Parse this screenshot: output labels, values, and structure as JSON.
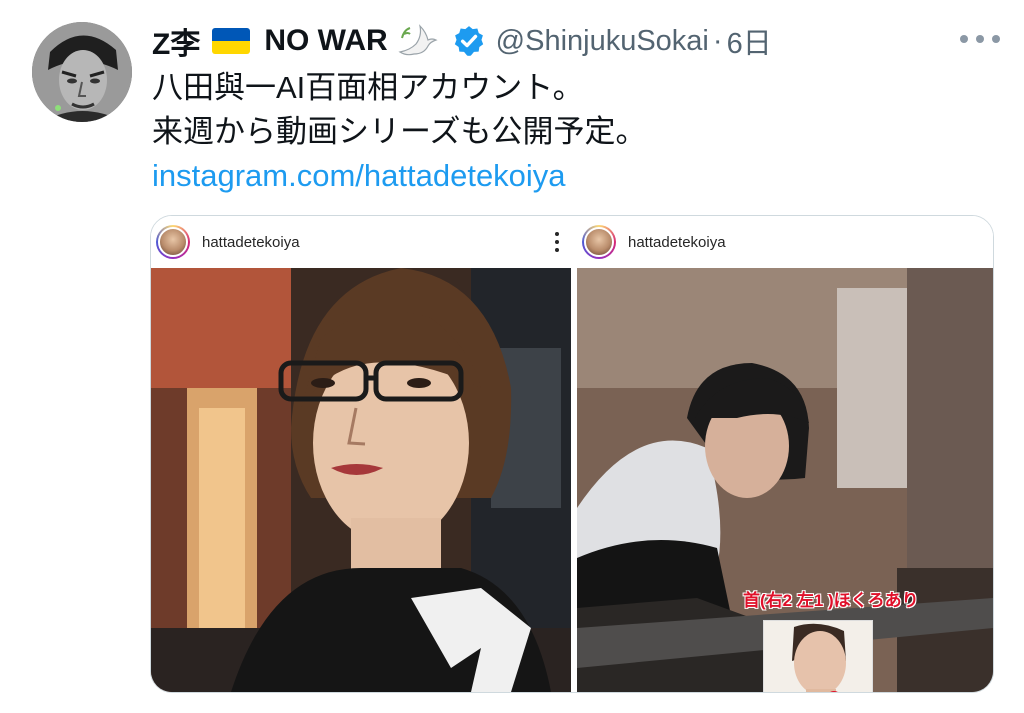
{
  "tweet": {
    "display_name": "Z李",
    "name_suffix": "NO WAR",
    "handle": "@ShinjukuSokai",
    "separator": "·",
    "time": "6日",
    "text_lines": [
      "八田與一AI百面相アカウント。",
      "来週から動画シリーズも公開予定。"
    ],
    "link": "instagram.com/hattadetekoiya"
  },
  "media": {
    "left": {
      "username": "hattadetekoiya"
    },
    "right": {
      "username": "hattadetekoiya",
      "annotation": "首(右2 左1 )ほくろあり"
    }
  },
  "icons": {
    "flag": "ukraine-flag-icon",
    "dove": "dove-icon",
    "verified": "verified-badge-icon",
    "more": "more-icon"
  },
  "colors": {
    "link": "#1d9bf0",
    "verified": "#1d9bf0",
    "secondary_text": "#536471",
    "annotation_red": "#e0102a"
  }
}
